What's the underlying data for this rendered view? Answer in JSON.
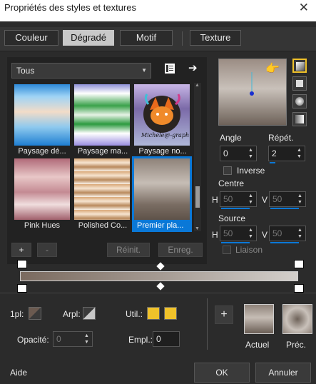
{
  "window": {
    "title": "Propriétés des styles et textures",
    "close": "✕"
  },
  "tabs": [
    "Couleur",
    "Dégradé",
    "Motif",
    "Texture"
  ],
  "category": {
    "selected": "Tous"
  },
  "thumbnails": [
    {
      "caption": "Paysage dé..."
    },
    {
      "caption": "Paysage ma..."
    },
    {
      "caption": "Paysage no..."
    },
    {
      "caption": "Pink Hues"
    },
    {
      "caption": "Polished Co..."
    },
    {
      "caption": "Premier pla..."
    }
  ],
  "thumb_watermark": "Michele@-graph",
  "list_buttons": {
    "add": "+",
    "remove": "-",
    "reset": "Réinit.",
    "save": "Enreg."
  },
  "angle": {
    "label": "Angle",
    "value": "0"
  },
  "repeat": {
    "label": "Répét.",
    "value": "2"
  },
  "invert_label": "Inverse",
  "center": {
    "label": "Centre",
    "h_label": "H",
    "h": "50",
    "v_label": "V",
    "v": "50"
  },
  "source": {
    "label": "Source",
    "h_label": "H",
    "h": "50",
    "v_label": "V",
    "v": "50"
  },
  "link_label": "Liaison",
  "bottom": {
    "opacity1_label": "1pl:",
    "arpl_label": "Arpl:",
    "util_label": "Util.:",
    "opacity_label": "Opacité:",
    "opacity_value": "0",
    "empl_label": "Empl.:",
    "empl_value": "0",
    "add": "+",
    "current_label": "Actuel",
    "previous_label": "Préc."
  },
  "footer": {
    "help": "Aide",
    "ok": "OK",
    "cancel": "Annuler"
  },
  "colors": {
    "accent": "#0a78d7",
    "swatch": "#f0c22a"
  }
}
